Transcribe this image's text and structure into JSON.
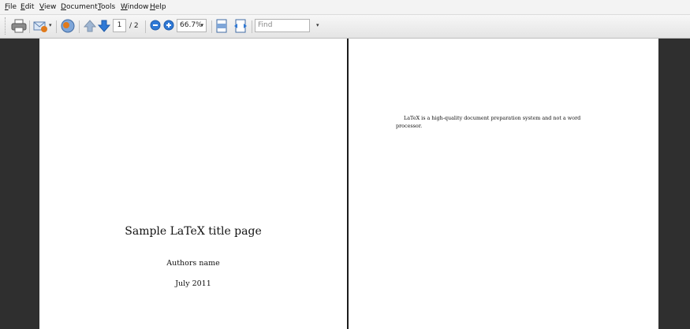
{
  "menu": {
    "items": [
      {
        "u": "F",
        "rest": "ile"
      },
      {
        "u": "E",
        "rest": "dit"
      },
      {
        "u": "V",
        "rest": "iew"
      },
      {
        "u": "D",
        "rest": "ocument"
      },
      {
        "u": "T",
        "rest": "ools"
      },
      {
        "u": "W",
        "rest": "indow"
      },
      {
        "u": "H",
        "rest": "elp"
      }
    ]
  },
  "toolbar": {
    "page_current": "1",
    "page_total": "/ 2",
    "zoom": "66.7%",
    "find_placeholder": "Find",
    "icons": [
      "print-icon",
      "email-icon",
      "upload-icon",
      "previous-page-icon",
      "next-page-icon",
      "zoom-out-icon",
      "zoom-in-icon",
      "fit-page-icon",
      "fit-width-icon"
    ],
    "colors": {
      "accent": "#2f79d6",
      "warning": "#e07a1c"
    }
  },
  "document": {
    "page1": {
      "title": "Sample LaTeX title page",
      "author": "Authors name",
      "date": "July 2011"
    },
    "page2": {
      "line1": "LaTeX is a high-quality document preparation system and not a word",
      "line2": "processor."
    }
  }
}
